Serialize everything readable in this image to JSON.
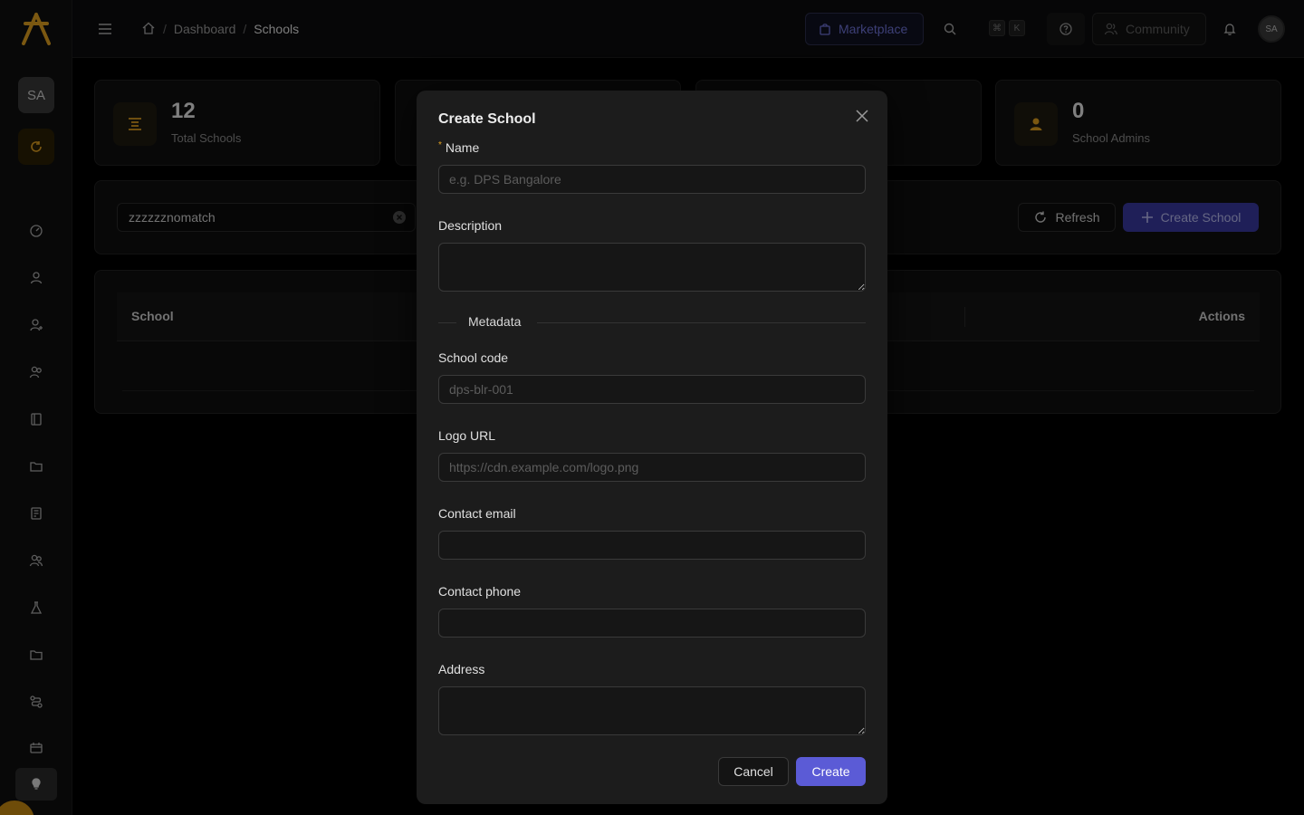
{
  "colors": {
    "accent": "#5b5bd6",
    "brand": "#e0a020",
    "background": "#000000"
  },
  "sidebar": {
    "avatar_initials": "SA",
    "icons": [
      "dashboard-icon",
      "user-icon",
      "user-plus-icon",
      "users-icon",
      "book-icon",
      "folder-icon",
      "document-icon",
      "group-icon",
      "flask-icon",
      "folder-icon",
      "route-icon",
      "calendar-icon",
      "bulb-icon"
    ]
  },
  "topbar": {
    "breadcrumb": {
      "home": "home-icon",
      "dashboard": "Dashboard",
      "current": "Schools",
      "separator": "/"
    },
    "marketplace_label": "Marketplace",
    "shortcut_keys": [
      "⌘",
      "K"
    ],
    "community_label": "Community",
    "avatar_initials": "SA"
  },
  "stats": [
    {
      "value": "12",
      "label": "Total Schools",
      "icon": "list-icon"
    },
    {
      "value": "0",
      "label": "School Admins",
      "icon": "person-icon"
    }
  ],
  "filters": {
    "search_value": "zzzzzznomatch",
    "refresh_label": "Refresh",
    "create_label": "Create School"
  },
  "table": {
    "columns": [
      "School",
      "Actions"
    ]
  },
  "modal": {
    "title": "Create School",
    "name_label": "Name",
    "name_placeholder": "e.g. DPS Bangalore",
    "description_label": "Description",
    "metadata_label": "Metadata",
    "school_code_label": "School code",
    "school_code_placeholder": "dps-blr-001",
    "logo_url_label": "Logo URL",
    "logo_url_placeholder": "https://cdn.example.com/logo.png",
    "contact_email_label": "Contact email",
    "contact_phone_label": "Contact phone",
    "address_label": "Address",
    "cancel_label": "Cancel",
    "create_label": "Create"
  }
}
